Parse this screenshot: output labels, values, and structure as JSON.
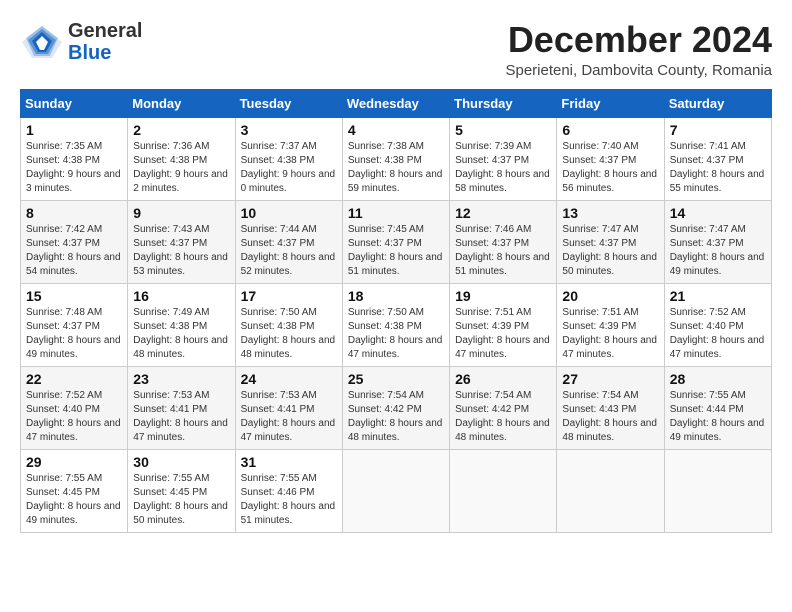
{
  "header": {
    "logo": {
      "general": "General",
      "blue": "Blue"
    },
    "title": "December 2024",
    "subtitle": "Sperieteni, Dambovita County, Romania"
  },
  "days_of_week": [
    "Sunday",
    "Monday",
    "Tuesday",
    "Wednesday",
    "Thursday",
    "Friday",
    "Saturday"
  ],
  "weeks": [
    [
      {
        "day": "1",
        "sunrise": "Sunrise: 7:35 AM",
        "sunset": "Sunset: 4:38 PM",
        "daylight": "Daylight: 9 hours and 3 minutes."
      },
      {
        "day": "2",
        "sunrise": "Sunrise: 7:36 AM",
        "sunset": "Sunset: 4:38 PM",
        "daylight": "Daylight: 9 hours and 2 minutes."
      },
      {
        "day": "3",
        "sunrise": "Sunrise: 7:37 AM",
        "sunset": "Sunset: 4:38 PM",
        "daylight": "Daylight: 9 hours and 0 minutes."
      },
      {
        "day": "4",
        "sunrise": "Sunrise: 7:38 AM",
        "sunset": "Sunset: 4:38 PM",
        "daylight": "Daylight: 8 hours and 59 minutes."
      },
      {
        "day": "5",
        "sunrise": "Sunrise: 7:39 AM",
        "sunset": "Sunset: 4:37 PM",
        "daylight": "Daylight: 8 hours and 58 minutes."
      },
      {
        "day": "6",
        "sunrise": "Sunrise: 7:40 AM",
        "sunset": "Sunset: 4:37 PM",
        "daylight": "Daylight: 8 hours and 56 minutes."
      },
      {
        "day": "7",
        "sunrise": "Sunrise: 7:41 AM",
        "sunset": "Sunset: 4:37 PM",
        "daylight": "Daylight: 8 hours and 55 minutes."
      }
    ],
    [
      {
        "day": "8",
        "sunrise": "Sunrise: 7:42 AM",
        "sunset": "Sunset: 4:37 PM",
        "daylight": "Daylight: 8 hours and 54 minutes."
      },
      {
        "day": "9",
        "sunrise": "Sunrise: 7:43 AM",
        "sunset": "Sunset: 4:37 PM",
        "daylight": "Daylight: 8 hours and 53 minutes."
      },
      {
        "day": "10",
        "sunrise": "Sunrise: 7:44 AM",
        "sunset": "Sunset: 4:37 PM",
        "daylight": "Daylight: 8 hours and 52 minutes."
      },
      {
        "day": "11",
        "sunrise": "Sunrise: 7:45 AM",
        "sunset": "Sunset: 4:37 PM",
        "daylight": "Daylight: 8 hours and 51 minutes."
      },
      {
        "day": "12",
        "sunrise": "Sunrise: 7:46 AM",
        "sunset": "Sunset: 4:37 PM",
        "daylight": "Daylight: 8 hours and 51 minutes."
      },
      {
        "day": "13",
        "sunrise": "Sunrise: 7:47 AM",
        "sunset": "Sunset: 4:37 PM",
        "daylight": "Daylight: 8 hours and 50 minutes."
      },
      {
        "day": "14",
        "sunrise": "Sunrise: 7:47 AM",
        "sunset": "Sunset: 4:37 PM",
        "daylight": "Daylight: 8 hours and 49 minutes."
      }
    ],
    [
      {
        "day": "15",
        "sunrise": "Sunrise: 7:48 AM",
        "sunset": "Sunset: 4:37 PM",
        "daylight": "Daylight: 8 hours and 49 minutes."
      },
      {
        "day": "16",
        "sunrise": "Sunrise: 7:49 AM",
        "sunset": "Sunset: 4:38 PM",
        "daylight": "Daylight: 8 hours and 48 minutes."
      },
      {
        "day": "17",
        "sunrise": "Sunrise: 7:50 AM",
        "sunset": "Sunset: 4:38 PM",
        "daylight": "Daylight: 8 hours and 48 minutes."
      },
      {
        "day": "18",
        "sunrise": "Sunrise: 7:50 AM",
        "sunset": "Sunset: 4:38 PM",
        "daylight": "Daylight: 8 hours and 47 minutes."
      },
      {
        "day": "19",
        "sunrise": "Sunrise: 7:51 AM",
        "sunset": "Sunset: 4:39 PM",
        "daylight": "Daylight: 8 hours and 47 minutes."
      },
      {
        "day": "20",
        "sunrise": "Sunrise: 7:51 AM",
        "sunset": "Sunset: 4:39 PM",
        "daylight": "Daylight: 8 hours and 47 minutes."
      },
      {
        "day": "21",
        "sunrise": "Sunrise: 7:52 AM",
        "sunset": "Sunset: 4:40 PM",
        "daylight": "Daylight: 8 hours and 47 minutes."
      }
    ],
    [
      {
        "day": "22",
        "sunrise": "Sunrise: 7:52 AM",
        "sunset": "Sunset: 4:40 PM",
        "daylight": "Daylight: 8 hours and 47 minutes."
      },
      {
        "day": "23",
        "sunrise": "Sunrise: 7:53 AM",
        "sunset": "Sunset: 4:41 PM",
        "daylight": "Daylight: 8 hours and 47 minutes."
      },
      {
        "day": "24",
        "sunrise": "Sunrise: 7:53 AM",
        "sunset": "Sunset: 4:41 PM",
        "daylight": "Daylight: 8 hours and 47 minutes."
      },
      {
        "day": "25",
        "sunrise": "Sunrise: 7:54 AM",
        "sunset": "Sunset: 4:42 PM",
        "daylight": "Daylight: 8 hours and 48 minutes."
      },
      {
        "day": "26",
        "sunrise": "Sunrise: 7:54 AM",
        "sunset": "Sunset: 4:42 PM",
        "daylight": "Daylight: 8 hours and 48 minutes."
      },
      {
        "day": "27",
        "sunrise": "Sunrise: 7:54 AM",
        "sunset": "Sunset: 4:43 PM",
        "daylight": "Daylight: 8 hours and 48 minutes."
      },
      {
        "day": "28",
        "sunrise": "Sunrise: 7:55 AM",
        "sunset": "Sunset: 4:44 PM",
        "daylight": "Daylight: 8 hours and 49 minutes."
      }
    ],
    [
      {
        "day": "29",
        "sunrise": "Sunrise: 7:55 AM",
        "sunset": "Sunset: 4:45 PM",
        "daylight": "Daylight: 8 hours and 49 minutes."
      },
      {
        "day": "30",
        "sunrise": "Sunrise: 7:55 AM",
        "sunset": "Sunset: 4:45 PM",
        "daylight": "Daylight: 8 hours and 50 minutes."
      },
      {
        "day": "31",
        "sunrise": "Sunrise: 7:55 AM",
        "sunset": "Sunset: 4:46 PM",
        "daylight": "Daylight: 8 hours and 51 minutes."
      },
      null,
      null,
      null,
      null
    ]
  ]
}
